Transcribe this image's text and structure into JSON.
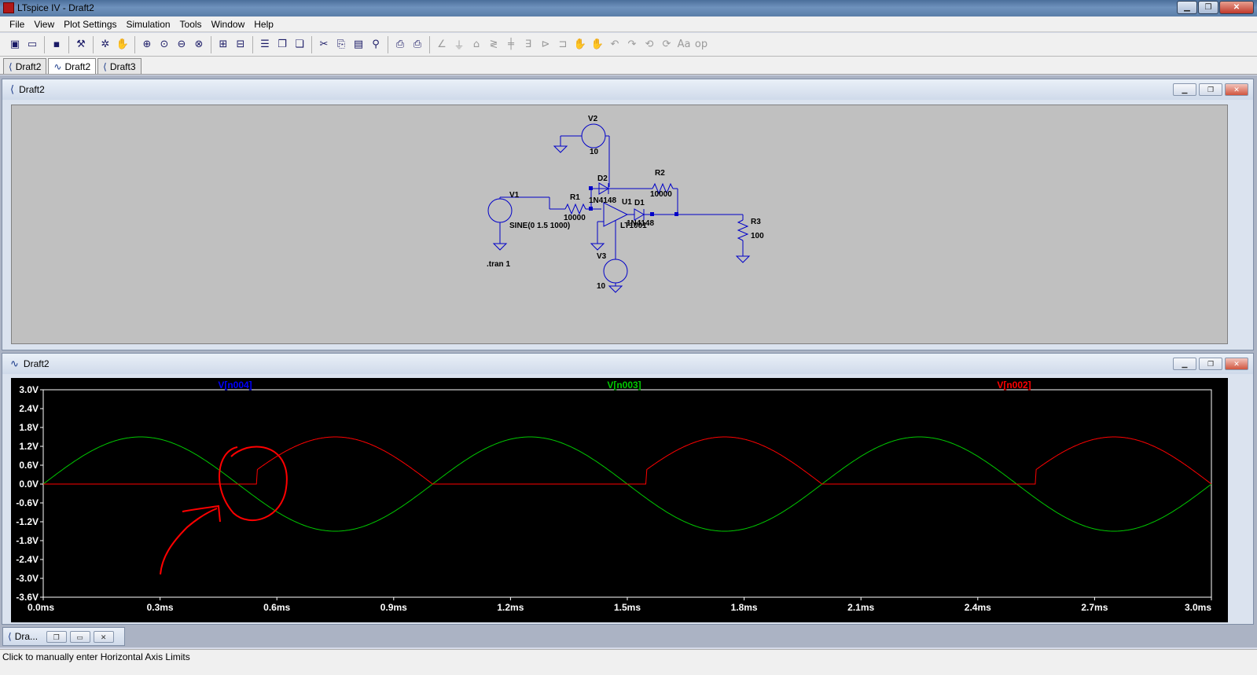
{
  "window": {
    "title": "LTspice IV - Draft2",
    "min": "▁",
    "max": "❐",
    "close": "✕"
  },
  "menu": [
    "File",
    "View",
    "Plot Settings",
    "Simulation",
    "Tools",
    "Window",
    "Help"
  ],
  "tabs": [
    {
      "label": "Draft2",
      "icon": "schematic-icon"
    },
    {
      "label": "Draft2",
      "icon": "waveform-icon",
      "active": true
    },
    {
      "label": "Draft3",
      "icon": "schematic-icon"
    }
  ],
  "schematic_window": {
    "title": "Draft2",
    "components": {
      "v2_name": "V2",
      "v2_value": "10",
      "v3_name": "V3",
      "v3_value": "10",
      "v1_name": "V1",
      "v1_value": "SINE(0 1.5 1000)",
      "r1_name": "R1",
      "r1_value": "10000",
      "r2_name": "R2",
      "r2_value": "10000",
      "r3_name": "R3",
      "r3_value": "100",
      "d1_name": "D1",
      "d1_value": "1N4148",
      "d2_name": "D2",
      "d2_value": "1N4148",
      "u1_name": "U1",
      "u1_value": "LT1001",
      "directive": ".tran 1"
    }
  },
  "plot_window": {
    "title": "Draft2"
  },
  "chart_data": {
    "type": "line",
    "series": [
      {
        "name": "V[n004]",
        "color": "#0000ff",
        "values": []
      },
      {
        "name": "V[n003]",
        "color": "#00c800",
        "description_shape": "sine",
        "amplitude": 1.5,
        "frequency_hz": 1000,
        "phase": "starts at 0 rising"
      },
      {
        "name": "V[n002]",
        "color": "#ff0000",
        "shape": "half-wave rectified inverted sine",
        "amplitude": 1.5,
        "jumps_at_ms": [
          0.55,
          1.55,
          2.55
        ]
      }
    ],
    "xlim": [
      0.0,
      3.0
    ],
    "ylim": [
      -3.6,
      3.0
    ],
    "x_ticks": [
      "0.0ms",
      "0.3ms",
      "0.6ms",
      "0.9ms",
      "1.2ms",
      "1.5ms",
      "1.8ms",
      "2.1ms",
      "2.4ms",
      "2.7ms",
      "3.0ms"
    ],
    "y_ticks": [
      "3.0V",
      "2.4V",
      "1.8V",
      "1.2V",
      "0.6V",
      "0.0V",
      "-0.6V",
      "-1.2V",
      "-1.8V",
      "-2.4V",
      "-3.0V",
      "-3.6V"
    ],
    "annotation": "red hand-drawn circle around 0.5ms zero-crossing with arrow"
  },
  "minimized": {
    "label": "Dra..."
  },
  "status": "Click to manually enter Horizontal Axis Limits"
}
